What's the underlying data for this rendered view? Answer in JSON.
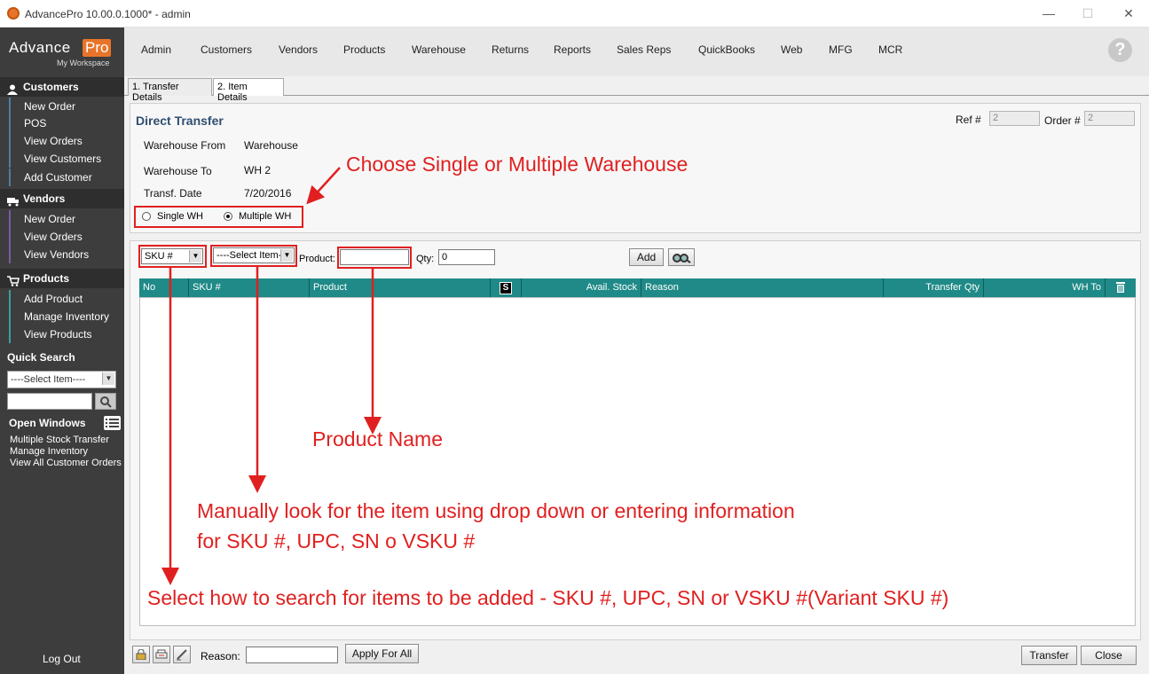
{
  "window": {
    "title": "AdvancePro 10.00.0.1000* - admin",
    "minimize": "—",
    "maximize": "☐",
    "close": "✕"
  },
  "logo": {
    "brand_a": "Advance",
    "brand_b": "Pro",
    "subtitle": "My Workspace"
  },
  "sidebar": {
    "customers": {
      "heading": "Customers",
      "items": [
        "New Order",
        "POS",
        "View Orders",
        "View Customers",
        "Add Customer"
      ]
    },
    "vendors": {
      "heading": "Vendors",
      "items": [
        "New Order",
        "View Orders",
        "View Vendors"
      ]
    },
    "products": {
      "heading": "Products",
      "items": [
        "Add Product",
        "Manage Inventory",
        "View Products"
      ]
    },
    "quick_search": {
      "label": "Quick Search",
      "select_value": "----Select Item----"
    },
    "open_windows": {
      "label": "Open Windows",
      "items": [
        "Multiple Stock Transfer",
        "Manage Inventory",
        "View All Customer Orders"
      ]
    },
    "logout": "Log Out"
  },
  "menu": [
    "Admin",
    "Customers",
    "Vendors",
    "Products",
    "Warehouse",
    "Returns",
    "Reports",
    "Sales Reps",
    "QuickBooks",
    "Web",
    "MFG",
    "MCR"
  ],
  "help": "?",
  "tabs": [
    "1. Transfer Details",
    "2. Item Details"
  ],
  "header": {
    "title": "Direct Transfer",
    "ref_label": "Ref #",
    "ref_value": "2",
    "order_label": "Order #",
    "order_value": "2",
    "warehouse_from_label": "Warehouse From",
    "warehouse_from_value": "Warehouse",
    "warehouse_to_label": "Warehouse To",
    "warehouse_to_value": "WH 2",
    "date_label": "Transf. Date",
    "date_value": "7/20/2016",
    "single_wh": "Single WH",
    "multiple_wh": "Multiple WH"
  },
  "search": {
    "type_value": "SKU #",
    "item_value": "----Select Item----",
    "product_label": "Product:",
    "qty_label": "Qty:",
    "qty_value": "0",
    "add_label": "Add"
  },
  "grid": {
    "columns": [
      "No",
      "SKU #",
      "Product",
      "S",
      "Avail. Stock",
      "Reason",
      "Transfer Qty",
      "WH To"
    ]
  },
  "footer": {
    "reason_label": "Reason:",
    "apply_label": "Apply For All",
    "transfer_label": "Transfer",
    "close_label": "Close"
  },
  "annotations": {
    "choose_wh": "Choose Single or Multiple Warehouse",
    "product_name": "Product Name",
    "manual_line1": "Manually look for the item using drop down or entering information",
    "manual_line2": "for SKU #, UPC, SN o VSKU #",
    "select_how": "Select how to search for items to be added - SKU #, UPC, SN or VSKU #(Variant SKU #)"
  },
  "colors": {
    "accent": "#e8742a",
    "grid_header": "#1f8a87",
    "annotation": "#e02020",
    "sidebar": "#3d3d3d"
  }
}
